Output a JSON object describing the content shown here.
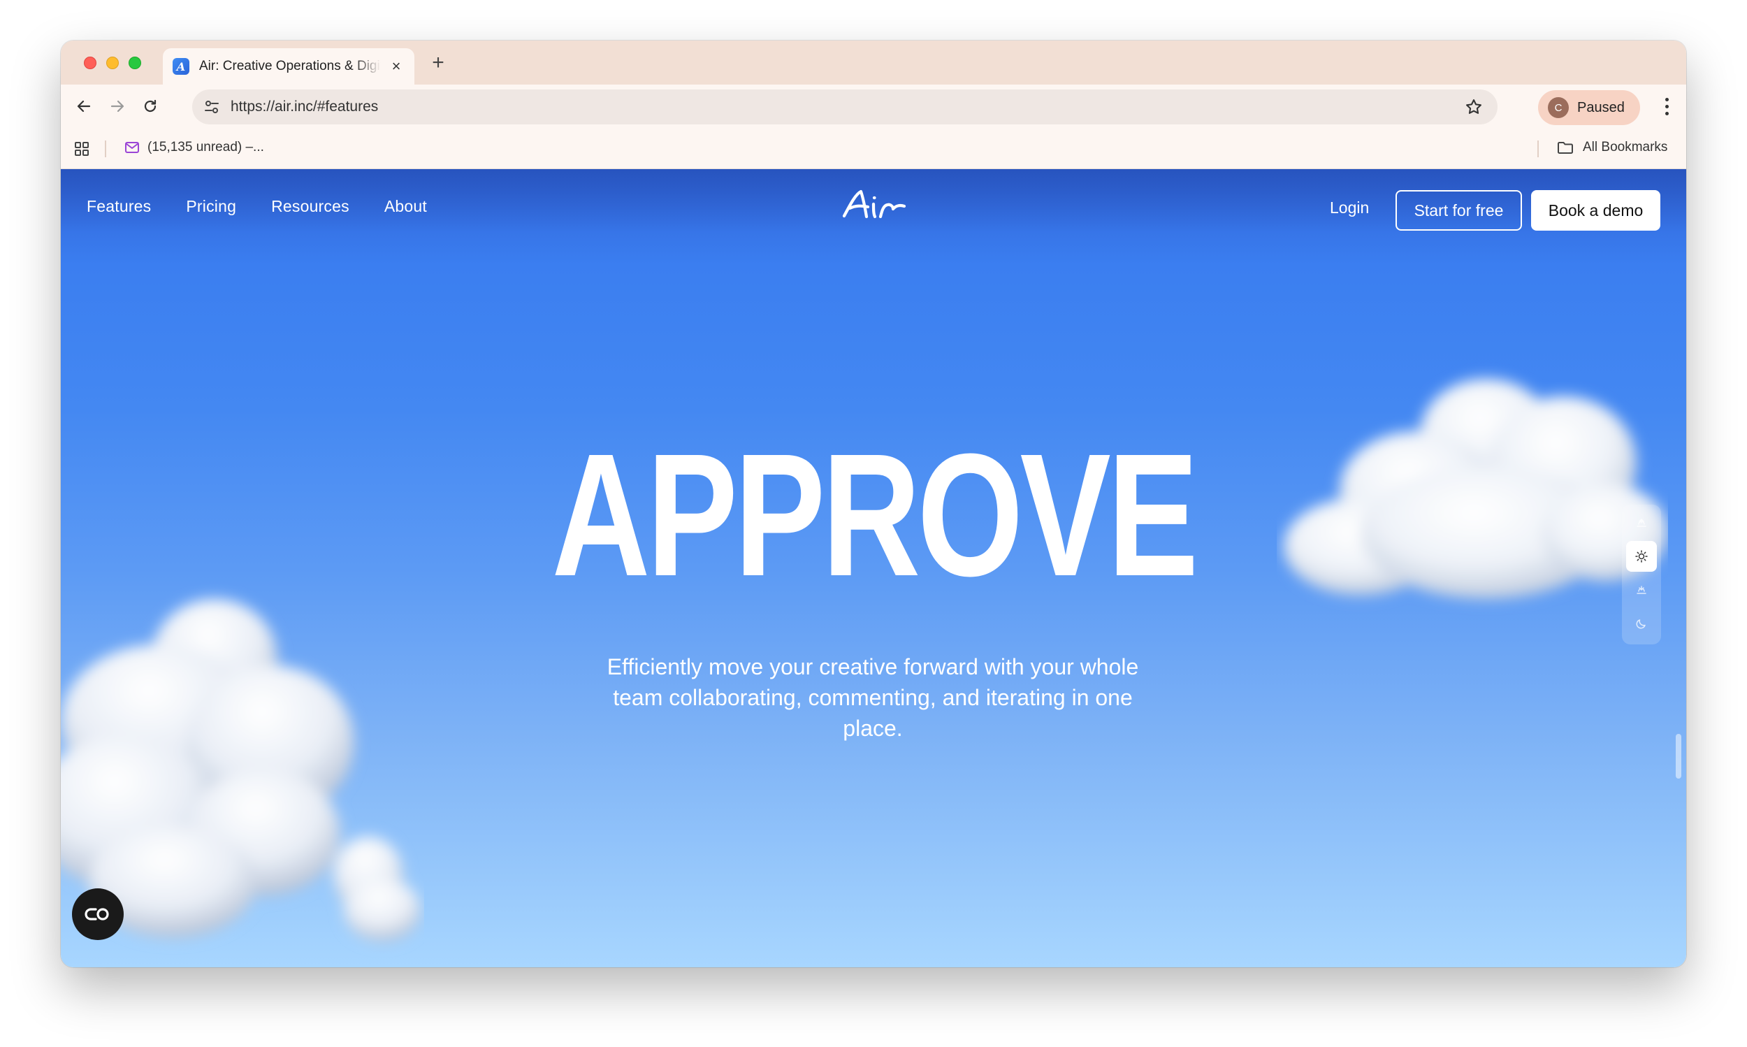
{
  "browser": {
    "tab": {
      "title": "Air: Creative Operations & Digital Asset Management",
      "favicon_letter": "A"
    },
    "url": "https://air.inc/#features",
    "profile": {
      "initial": "C",
      "status": "Paused"
    },
    "bookmarks": {
      "mail_label": "(15,135 unread) –...",
      "all_label": "All Bookmarks"
    }
  },
  "site": {
    "nav": [
      "Features",
      "Pricing",
      "Resources",
      "About"
    ],
    "logo_text": "Air",
    "login": "Login",
    "start_cta": "Start for free",
    "demo_cta": "Book a demo"
  },
  "hero": {
    "title": "APPROVE",
    "subtitle": "Efficiently move your creative forward with your whole team collaborating, commenting, and iterating in one place."
  },
  "theme_switcher": {
    "options": [
      "dawn",
      "day",
      "dusk",
      "night"
    ],
    "active": "day"
  },
  "colors": {
    "sky_top": "#2f63d8",
    "sky_bottom": "#a8d6ff",
    "tabstrip": "#f2dfd4",
    "toolbar": "#fdf6f2"
  }
}
